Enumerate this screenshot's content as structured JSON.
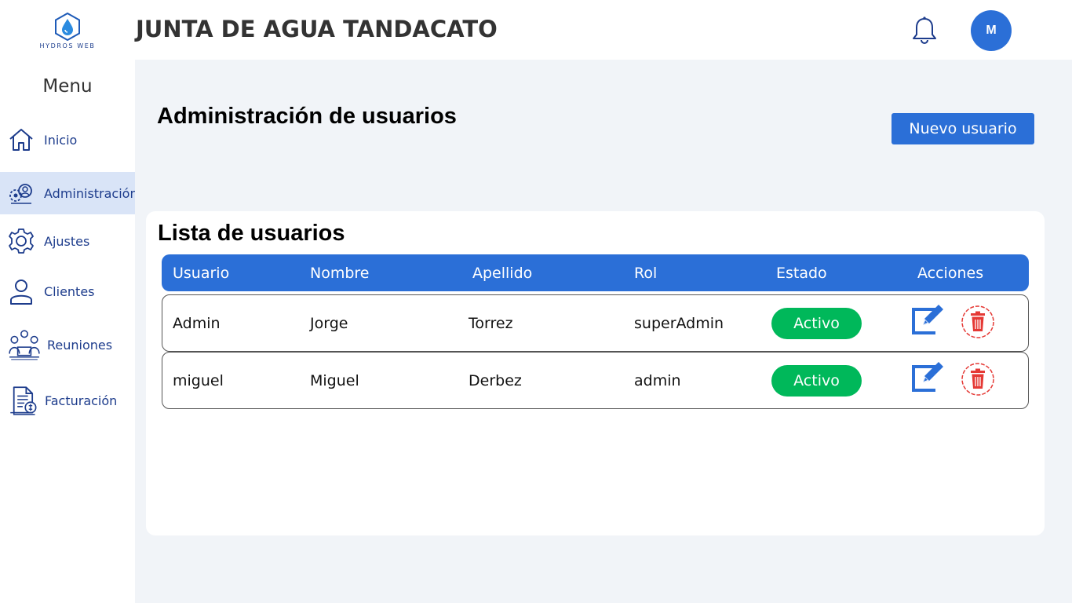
{
  "header": {
    "logo_text": "HYDROS WEB",
    "app_title": "JUNTA DE AGUA TANDACATO",
    "avatar_initial": "M"
  },
  "sidebar": {
    "menu_title": "Menu",
    "items": [
      {
        "label": "Inicio",
        "icon": "home-icon"
      },
      {
        "label": "Administración",
        "icon": "admin-icon",
        "active": true
      },
      {
        "label": "Ajustes",
        "icon": "gear-icon"
      },
      {
        "label": "Clientes",
        "icon": "user-icon"
      },
      {
        "label": "Reuniones",
        "icon": "meeting-icon"
      },
      {
        "label": "Facturación",
        "icon": "invoice-icon"
      }
    ]
  },
  "main": {
    "page_title": "Administración de usuarios",
    "new_user_label": "Nuevo usuario",
    "list_title": "Lista de usuarios",
    "columns": [
      "Usuario",
      "Nombre",
      "Apellido",
      "Rol",
      "Estado",
      "Acciones"
    ],
    "rows": [
      {
        "usuario": "Admin",
        "nombre": "Jorge",
        "apellido": "Torrez",
        "rol": "superAdmin",
        "estado": "Activo"
      },
      {
        "usuario": "miguel",
        "nombre": "Miguel",
        "apellido": "Derbez",
        "rol": "admin",
        "estado": "Activo"
      }
    ]
  },
  "colors": {
    "primary": "#2b6fd7",
    "active_badge": "#00b85a",
    "delete": "#e53935",
    "sidebar_active": "#d9e4f7",
    "background": "#f1f4f8"
  }
}
